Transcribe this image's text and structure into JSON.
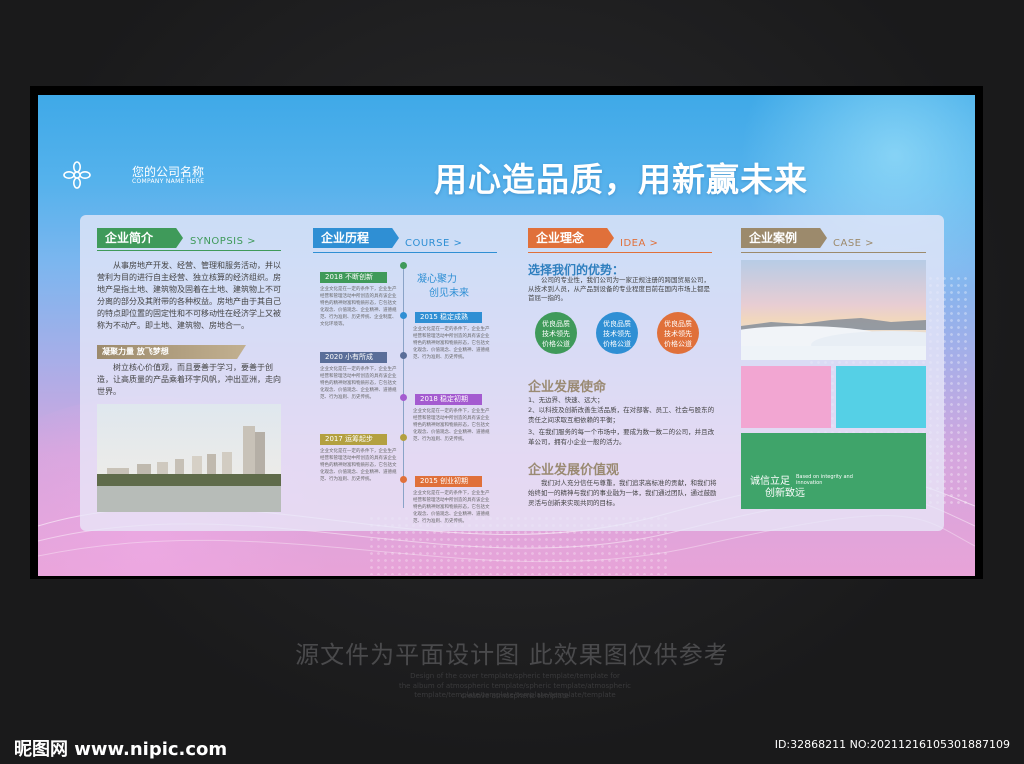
{
  "header": {
    "company_name": "您的公司名称",
    "company_en": "COMPANY NAME HERE",
    "slogan": "用心造品质，用新赢未来"
  },
  "synopsis": {
    "tag": "企业简介",
    "en": "SYNOPSIS >",
    "paragraph": "从事房地产开发、经营、管理和服务活动，并以营利为目的进行自主经营、独立核算的经济组织。房地产是指土地、建筑物及固着在土地、建筑物上不可分离的部分及其附带的各种权益。房地产由于其自己的特点即位置的固定性和不可移动性在经济学上又被称为不动产。即土地、建筑物、房地合一。",
    "sub_tag": "凝聚力量 放飞梦想",
    "sub_text": "树立核心价值观，而且要善于学习，要善于创造，让高质量的产品乘着环宇风帆，冲出亚洲，走向世界。"
  },
  "course": {
    "tag": "企业历程",
    "en": "COURSE >",
    "motto_line1": "凝心聚力",
    "motto_line2": "创见未来",
    "items": [
      {
        "year": "2018 不断创新",
        "text": "企业文化是在一定的条件下，企业生产经营和管理活动中所创造的具有该企业特色的精神财富和物质形态，它包括文化观念、价值观念、企业精神、道德规范、行为准则、历史传统、企业制度、文化环境等。"
      },
      {
        "year": "2015 稳定成熟",
        "text": "企业文化是在一定的条件下，企业生产经营和管理活动中所创造的具有该企业特色的精神财富和物质形态，它包括文化观念、价值观念、企业精神、道德规范、行为准则、历史传统。"
      },
      {
        "year": "2020 小有所成",
        "text": "企业文化是在一定的条件下，企业生产经营和管理活动中所创造的具有该企业特色的精神财富和物质形态，它包括文化观念、价值观念、企业精神、道德规范、行为准则、历史传统。"
      },
      {
        "year": "2018 稳定初期",
        "text": "企业文化是在一定的条件下，企业生产经营和管理活动中所创造的具有该企业特色的精神财富和物质形态，它包括文化观念、价值观念、企业精神、道德规范、行为准则、历史传统。"
      },
      {
        "year": "2017 运筹起步",
        "text": "企业文化是在一定的条件下，企业生产经营和管理活动中所创造的具有该企业特色的精神财富和物质形态，它包括文化观念、价值观念、企业精神、道德规范、行为准则、历史传统。"
      },
      {
        "year": "2015 创业初期",
        "text": "企业文化是在一定的条件下，企业生产经营和管理活动中所创造的具有该企业特色的精神财富和物质形态，它包括文化观念、价值观念、企业精神、道德规范、行为准则、历史传统。"
      }
    ]
  },
  "idea": {
    "tag": "企业理念",
    "en": "IDEA >",
    "advantage_title": "选择我们的优势：",
    "advantage_text": "公司的专业性，我们公司为一家正规注册的跨国贸易公司，从技术到人员，从产品到设备的专业程度目前在国内市场上都是首屈一指的。",
    "circles": [
      {
        "line1": "优良品质",
        "line2": "技术领先",
        "line3": "价格公道"
      },
      {
        "line1": "优良品质",
        "line2": "技术领先",
        "line3": "价格公道"
      },
      {
        "line1": "优良品质",
        "line2": "技术领先",
        "line3": "价格公道"
      }
    ],
    "mission_title": "企业发展使命",
    "mission_items": [
      "1、无边界、快速、远大；",
      "2、以科技及创新改善生活品质，在对部客、员工、社会与股东的责任之间求取互相依赖的平衡；",
      "3、在我们服务的每一个市场中，要成为数一数二的公司，并且改革公司，拥有小企业一般的活力。"
    ],
    "value_title": "企业发展价值观",
    "value_text": "我们对人充分信任与尊重，我们追求高标准的贡献，和我们将始终如一的精神与我们的事业融为一体，我们通过团队，通过鼓励灵活与创新来实现共同的目标。"
  },
  "case": {
    "tag": "企业案例",
    "en": "CASE >",
    "slogan_cn_1": "诚信立足",
    "slogan_cn_2": "创新致远",
    "slogan_en": "Based on integrity and innovation"
  },
  "captions": {
    "main": "源文件为平面设计图 此效果图仅供参考",
    "sub1": "Design of the cover template/spheric template/template for",
    "sub2": "the album of atmospheric template/spheric template/atmospheric template/template/template/template/template/template",
    "sub3": "creative atmospheric template"
  },
  "watermark": {
    "left": "昵图网 www.nipic.com",
    "right": "ID:32868211 NO:20211216105301887109"
  },
  "colors": {
    "green": "#3f9a5a",
    "blue": "#2f8fd4",
    "orange": "#e0703a",
    "brown": "#9c8a6c"
  }
}
